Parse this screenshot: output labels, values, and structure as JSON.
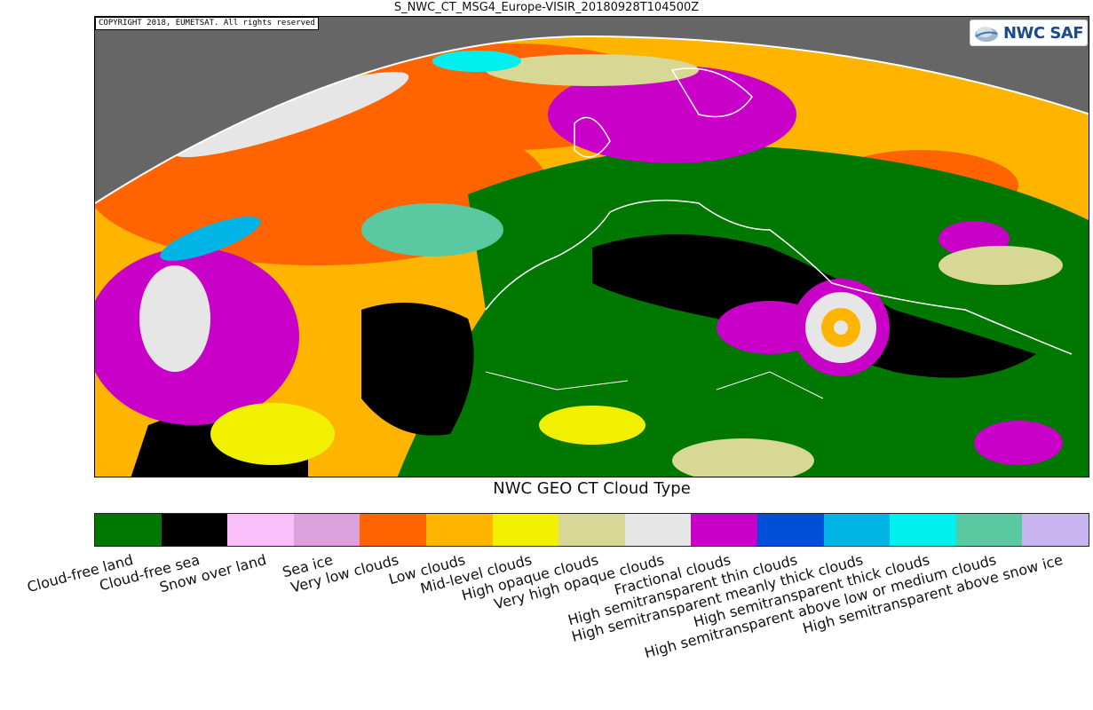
{
  "title": "S_NWC_CT_MSG4_Europe-VISIR_20180928T104500Z",
  "copyright": "COPYRIGHT 2018, EUMETSAT. All rights reserved",
  "logo": {
    "text": "NWC SAF",
    "icon": "nwcsaf-logo-icon"
  },
  "map": {
    "background_color": "#666666",
    "border_color": "#ffffff"
  },
  "legend": {
    "title": "NWC GEO CT Cloud Type",
    "categories": [
      {
        "label": "Cloud-free land",
        "color": "#007800"
      },
      {
        "label": "Cloud-free sea",
        "color": "#000000"
      },
      {
        "label": "Snow over land",
        "color": "#fabefa"
      },
      {
        "label": "Sea ice",
        "color": "#dca0dc"
      },
      {
        "label": "Very low clouds",
        "color": "#ff6400"
      },
      {
        "label": "Low clouds",
        "color": "#ffb400"
      },
      {
        "label": "Mid-level clouds",
        "color": "#f0f000"
      },
      {
        "label": "High opaque clouds",
        "color": "#d7d796"
      },
      {
        "label": "Very high opaque clouds",
        "color": "#e6e6e6"
      },
      {
        "label": "Fractional clouds",
        "color": "#c800c8"
      },
      {
        "label": "High semitransparent thin clouds",
        "color": "#0050d7"
      },
      {
        "label": "High semitransparent meanly thick clouds",
        "color": "#00b4e6"
      },
      {
        "label": "High semitransparent thick clouds",
        "color": "#00f0f0"
      },
      {
        "label": "High semitransparent above low or medium clouds",
        "color": "#5ac8a0"
      },
      {
        "label": "High semitransparent above snow ice",
        "color": "#c8b4f0"
      }
    ]
  }
}
